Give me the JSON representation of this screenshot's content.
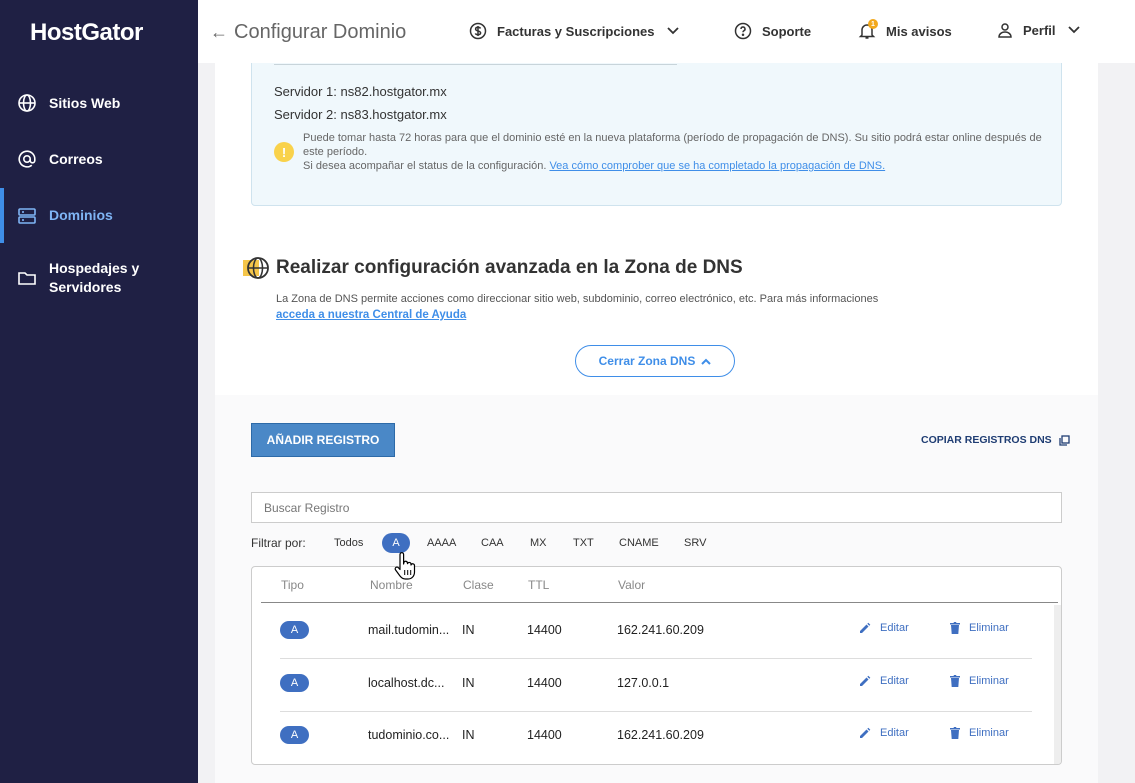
{
  "app": {
    "logo": "HostGator"
  },
  "sidebar": {
    "items": [
      {
        "label": "Sitios Web",
        "icon": "globe-icon"
      },
      {
        "label": "Correos",
        "icon": "at-icon"
      },
      {
        "label": "Dominios",
        "icon": "server-icon",
        "active": true
      },
      {
        "label": "Hospedajes y Servidores",
        "icon": "folder-icon"
      }
    ]
  },
  "topbar": {
    "title": "Configurar Dominio",
    "billing": "Facturas y Suscripciones",
    "support": "Soporte",
    "notices": "Mis avisos",
    "notices_count": "1",
    "profile": "Perfil"
  },
  "dns_info": {
    "server1_label": "Servidor 1:",
    "server1_value": "ns82.hostgator.mx",
    "server2_label": "Servidor 2:",
    "server2_value": "ns83.hostgator.mx",
    "warning_line1": "Puede tomar hasta 72 horas para que el dominio esté en la nueva plataforma (período de propagación de DNS). Su sitio podrá estar online después de este período.",
    "warning_line2": "Si desea acompañar el status de la configuración.",
    "warning_link": "Vea cómo comprober que se ha completado la propagación de DNS."
  },
  "advanced": {
    "title": "Realizar configuración avanzada en la Zona de DNS",
    "description": "La Zona de DNS permite acciones como direccionar sitio web, subdominio, correo electrónico, etc. Para más informaciones",
    "help_link": "acceda a nuestra Central de Ayuda",
    "close_button": "Cerrar Zona DNS"
  },
  "records": {
    "add_button": "AÑADIR REGISTRO",
    "copy_button": "COPIAR REGISTROS DNS",
    "search_placeholder": "Buscar Registro",
    "filter_label": "Filtrar por:",
    "filters": [
      "Todos",
      "A",
      "AAAA",
      "CAA",
      "MX",
      "TXT",
      "CNAME",
      "SRV"
    ],
    "active_filter": "A",
    "columns": [
      "Tipo",
      "Nombre",
      "Clase",
      "TTL",
      "Valor"
    ],
    "edit_label": "Editar",
    "delete_label": "Eliminar",
    "rows": [
      {
        "type": "A",
        "name": "mail.tudomin...",
        "class": "IN",
        "ttl": "14400",
        "value": "162.241.60.209"
      },
      {
        "type": "A",
        "name": "localhost.dc...",
        "class": "IN",
        "ttl": "14400",
        "value": "127.0.0.1"
      },
      {
        "type": "A",
        "name": "tudominio.co...",
        "class": "IN",
        "ttl": "14400",
        "value": "162.241.60.209"
      }
    ]
  },
  "colors": {
    "sidebar_bg": "#1f2044",
    "accent": "#3f8ee8",
    "pill": "#3f6fc1",
    "button": "#4a88c7"
  }
}
